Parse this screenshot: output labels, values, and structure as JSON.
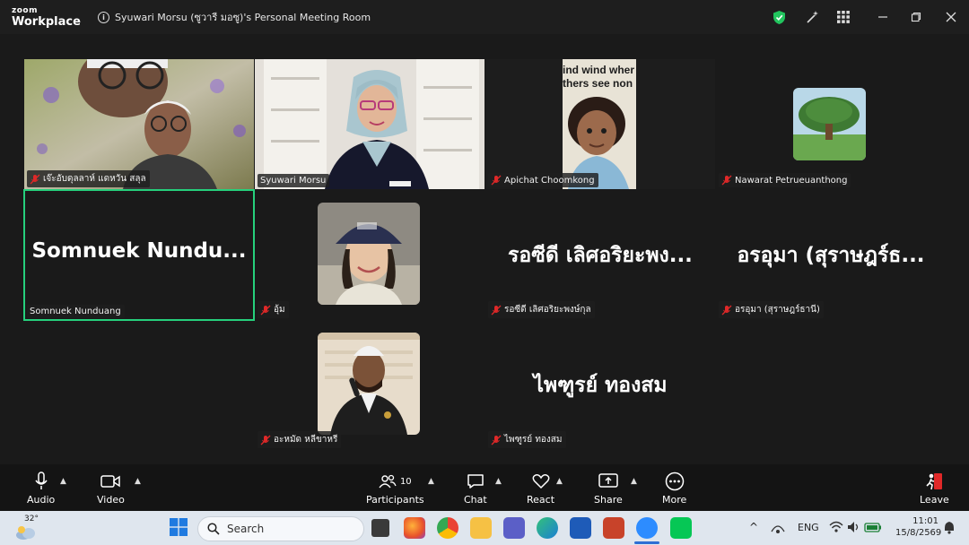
{
  "app": {
    "logo_top": "zoom",
    "logo_bottom": "Workplace"
  },
  "window": {
    "title": "Syuwari Morsu (ซูวารี มอซู)'s Personal Meeting Room"
  },
  "participants": [
    {
      "name": "เจ๊ะอับดุลลาห์ แดหวัน สลุล",
      "muted": true,
      "kind": "video"
    },
    {
      "name": "Syuwari Morsu",
      "muted": false,
      "kind": "video"
    },
    {
      "name": "Apichat Choomkong",
      "muted": true,
      "kind": "video"
    },
    {
      "name": "Nawarat Petrueuanthong",
      "muted": true,
      "kind": "avatar"
    },
    {
      "name": "Somnuek Nunduang",
      "display": "Somnuek Nundu...",
      "muted": false,
      "kind": "name",
      "active": true
    },
    {
      "name": "อุ้ม",
      "muted": true,
      "kind": "avatar"
    },
    {
      "name": "รอซีดี เลิศอริยะพงษ์กุล",
      "display": "รอซีดี เลิศอริยะพง...",
      "muted": true,
      "kind": "name"
    },
    {
      "name": "อรอุมา (สุราษฎร์ธานี)",
      "display": "อรอุมา (สุราษฎร์ธ...",
      "muted": true,
      "kind": "name"
    },
    {
      "name": "อะหมัด หลีขาหรี",
      "muted": true,
      "kind": "avatar"
    },
    {
      "name": "ไพฑูรย์ ทองสม",
      "display": "ไพฑูรย์ ทองสม",
      "muted": true,
      "kind": "name"
    }
  ],
  "video_overlay_text": {
    "line1": "ind wind wher",
    "line2": "thers see non"
  },
  "controls": {
    "audio": "Audio",
    "video": "Video",
    "participants": "Participants",
    "participants_count": "10",
    "chat": "Chat",
    "react": "React",
    "share": "Share",
    "more": "More",
    "leave": "Leave"
  },
  "taskbar": {
    "weather": "32°",
    "search_placeholder": "Search",
    "language": "ENG",
    "time": "11:01",
    "date": "15/8/2569"
  },
  "colors": {
    "active_speaker": "#26d07c",
    "mute_red": "#e02828",
    "leave_red": "#e02828",
    "shield_green": "#22c55e"
  }
}
